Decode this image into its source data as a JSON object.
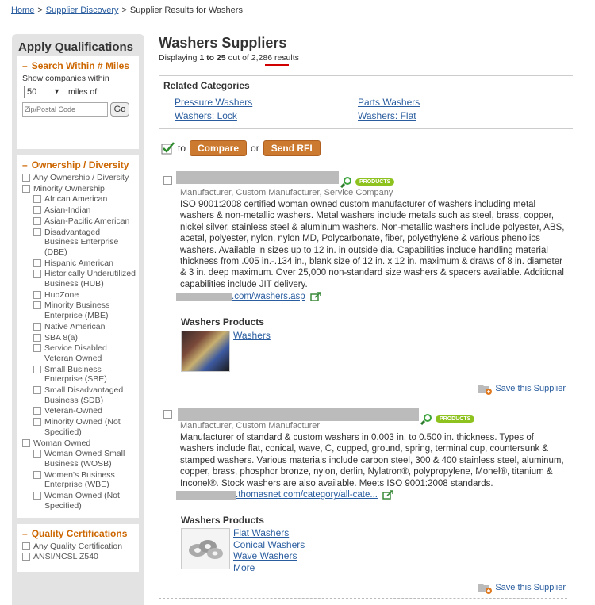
{
  "breadcrumb": {
    "home": "Home",
    "supplier_discovery": "Supplier Discovery",
    "current": "Supplier Results for Washers",
    "sep": ">"
  },
  "sidebar": {
    "title": "Apply Qualifications",
    "search_within": {
      "heading": "Search Within # Miles",
      "show_text": "Show companies within",
      "miles_value": "50",
      "miles_of": "miles of:",
      "zip_placeholder": "Zip/Postal Code",
      "go_label": "Go"
    },
    "ownership": {
      "heading": "Ownership / Diversity",
      "items": [
        "Any Ownership / Diversity",
        "Minority Ownership",
        "African American",
        "Asian-Indian",
        "Asian-Pacific American",
        "Disadvantaged Business Enterprise (DBE)",
        "Hispanic American",
        "Historically Underutilized Business (HUB)",
        "HubZone",
        "Minority Business Enterprise (MBE)",
        "Native American",
        "SBA 8(a)",
        "Service Disabled Veteran Owned",
        "Small Business Enterprise (SBE)",
        "Small Disadvantaged Business (SDB)",
        "Veteran-Owned",
        "Minority Owned (Not Specified)",
        "Woman Owned",
        "Woman Owned Small Business (WOSB)",
        "Women's Business Enterprise (WBE)",
        "Woman Owned (Not Specified)"
      ]
    },
    "quality": {
      "heading": "Quality Certifications",
      "items": [
        "Any Quality Certification",
        "ANSI/NCSL Z540"
      ]
    }
  },
  "main": {
    "title": "Washers Suppliers",
    "displaying_prefix": "Displaying",
    "range": "1 to 25",
    "out_of": "out of",
    "total": "2,286",
    "results": "results",
    "related": {
      "title": "Related Categories",
      "links": [
        "Pressure Washers",
        "Parts Washers",
        "Washers: Lock",
        "Washers: Flat"
      ]
    },
    "compare_row": {
      "to": "to",
      "compare": "Compare",
      "or": "or",
      "send_rfi": "Send RFI"
    },
    "listings": [
      {
        "badge": "PRODUCTS",
        "types": "Manufacturer, Custom Manufacturer, Service Company",
        "description": "ISO 9001:2008 certified woman owned custom manufacturer of washers including metal washers & non-metallic washers. Metal washers include metals such as steel, brass, copper, nickel silver, stainless steel & aluminum washers. Non-metallic washers include polyester, ABS, acetal, polyester, nylon, nylon MD, Polycarbonate, fiber, polyethylene & various phenolics washers. Available in sizes up to 12 in. in outside dia. Capabilities include handling material thickness from .005 in.-.134 in., blank size of 12 in. x 12 in. maximum & draws of 8 in. diameter & 3 in. deep maximum. Over 25,000 non-standard size washers & spacers available. Additional capabilities include JIT delivery.",
        "url": ".com/washers.asp",
        "products_heading": "Washers Products",
        "products": [
          "Washers"
        ],
        "save": "Save this Supplier"
      },
      {
        "badge": "PRODUCTS",
        "types": "Manufacturer, Custom Manufacturer",
        "description": "Manufacturer of standard & custom washers in 0.003 in. to 0.500 in. thickness. Types of washers include flat, conical, wave, C, cupped, ground, spring, terminal cup, countersunk & stamped washers. Various materials include carbon steel, 300 & 400 stainless steel, aluminum, copper, brass, phosphor bronze, nylon, derlin, Nylatron®, polypropylene, Monel®, titanium & Inconel®. Stock washers are also available. Meets ISO 9001:2008 standards.",
        "url": ".thomasnet.com/category/all-cate...",
        "products_heading": "Washers Products",
        "products": [
          "Flat Washers",
          "Conical Washers",
          "Wave Washers",
          "More"
        ],
        "save": "Save this Supplier"
      }
    ]
  },
  "colors": {
    "accent_orange": "#cc6600",
    "link_blue": "#2a5d9f",
    "badge_green": "#8ec21f",
    "button_orange": "#cc7a2f",
    "highlight_red": "#d00000"
  }
}
